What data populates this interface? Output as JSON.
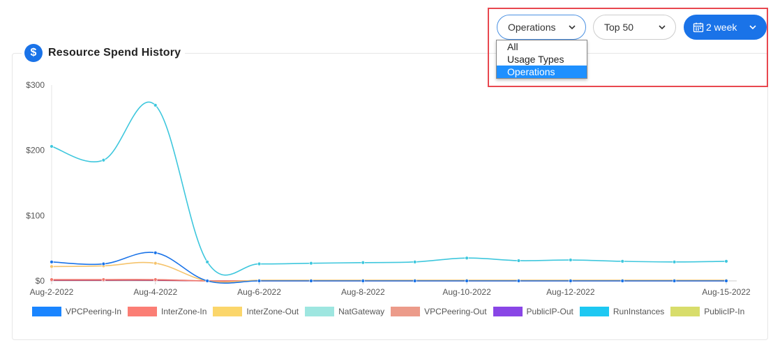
{
  "card": {
    "title": "Resource Spend History",
    "icon": "dollar-icon"
  },
  "controls": {
    "group_by": {
      "value": "Operations",
      "options": [
        "All",
        "Usage Types",
        "Operations"
      ],
      "selected_index": 2
    },
    "top": {
      "value": "Top 50"
    },
    "range": {
      "value": "2 week",
      "icon": "calendar-icon"
    }
  },
  "colors": {
    "accent": "#1a73e8",
    "highlight_border": "#e8474f",
    "selected_option": "#1e90ff"
  },
  "chart_data": {
    "type": "line",
    "y_ticks": [
      "$300",
      "$200",
      "$100",
      "$0"
    ],
    "ylim": [
      0,
      300
    ],
    "x_tick_labels": [
      "Aug-2-2022",
      "Aug-4-2022",
      "Aug-6-2022",
      "Aug-8-2022",
      "Aug-10-2022",
      "Aug-12-2022",
      "Aug-15-2022"
    ],
    "x": [
      "Aug-2-2022",
      "Aug-3-2022",
      "Aug-4-2022",
      "Aug-5-2022",
      "Aug-6-2022",
      "Aug-7-2022",
      "Aug-8-2022",
      "Aug-9-2022",
      "Aug-10-2022",
      "Aug-11-2022",
      "Aug-12-2022",
      "Aug-13-2022",
      "Aug-14-2022",
      "Aug-15-2022"
    ],
    "series": [
      {
        "name": "RunInstances",
        "color": "#3ec7dd",
        "values": [
          206,
          185,
          269,
          29,
          26,
          27,
          28,
          29,
          35,
          31,
          32,
          30,
          29,
          30
        ]
      },
      {
        "name": "VPCPeering-In",
        "color": "#1a73e8",
        "values": [
          29,
          26,
          43,
          0,
          0,
          0,
          0,
          0,
          0,
          0,
          0,
          0,
          0,
          0
        ]
      },
      {
        "name": "InterZone-Out",
        "color": "#f5c36b",
        "values": [
          22,
          23,
          27,
          0,
          1,
          1,
          1,
          1,
          1,
          1,
          1,
          1,
          1,
          1
        ]
      },
      {
        "name": "InterZone-In",
        "color": "#f0786e",
        "values": [
          2,
          2,
          2,
          0,
          0,
          0,
          0,
          0,
          0,
          0,
          0,
          0,
          0,
          0
        ]
      },
      {
        "name": "PublicIP-Out",
        "color": "#b23a66",
        "values": [
          1,
          1,
          1,
          0,
          0,
          0,
          0,
          0,
          0,
          0,
          0,
          0,
          0,
          0
        ]
      }
    ],
    "legend": [
      {
        "name": "VPCPeering-In",
        "color": "#1a85ff"
      },
      {
        "name": "InterZone-In",
        "color": "#fb7e75"
      },
      {
        "name": "InterZone-Out",
        "color": "#fbd66b"
      },
      {
        "name": "NatGateway",
        "color": "#9ee6e0"
      },
      {
        "name": "VPCPeering-Out",
        "color": "#ec9b8a"
      },
      {
        "name": "PublicIP-Out",
        "color": "#8946e6"
      },
      {
        "name": "RunInstances",
        "color": "#1ec8f2"
      },
      {
        "name": "PublicIP-In",
        "color": "#d8dd6b"
      }
    ]
  }
}
